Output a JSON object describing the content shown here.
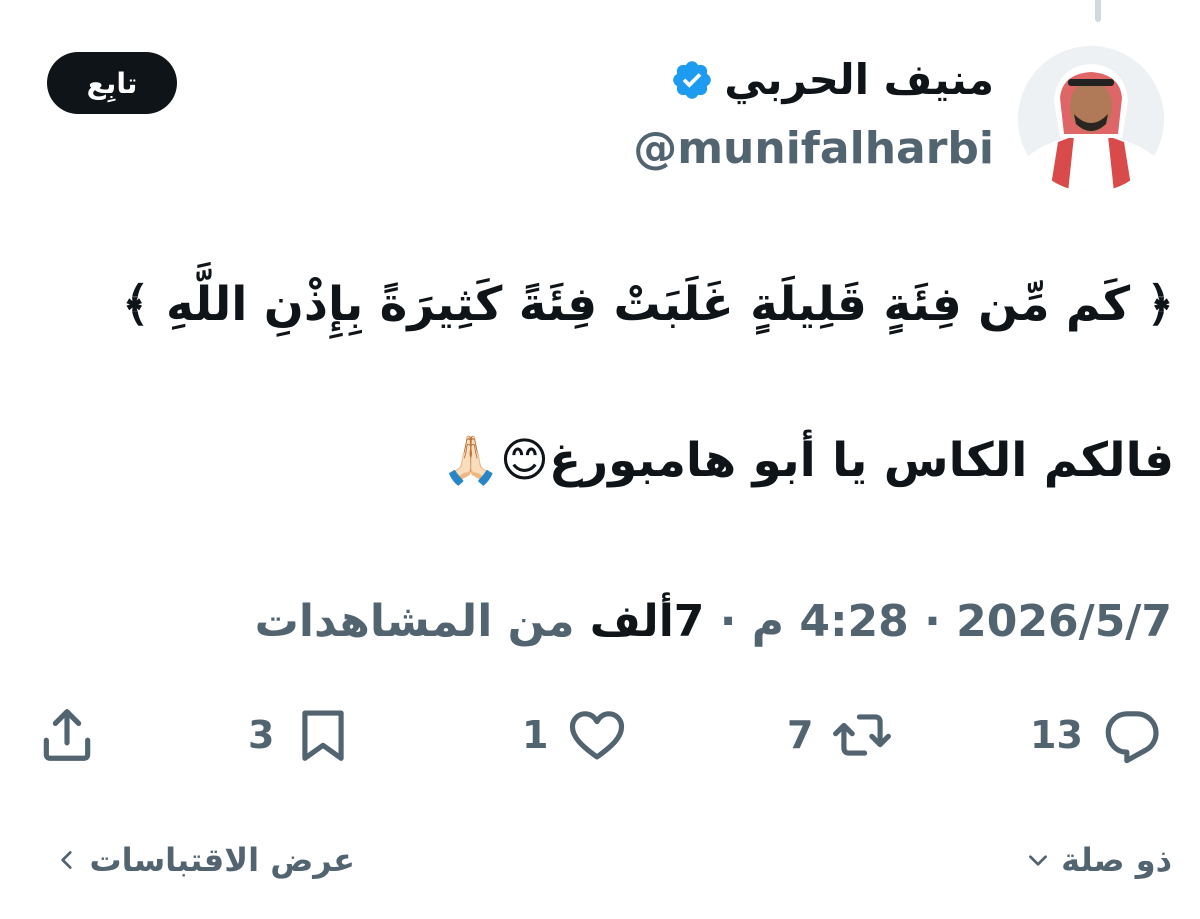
{
  "author": {
    "display_name": "منيف الحربي",
    "handle": "@munifalharbi",
    "verified": true
  },
  "follow_button": {
    "label": "تابِع"
  },
  "tweet": {
    "line1": "﴿ كَم مِّن فِئَةٍ قَلِيلَةٍ غَلَبَتْ فِئَةً كَثِيرَةً بِإِذْنِ اللَّهِ ﴾",
    "line2": "فالكم الكاس يا أبو هامبورغ😊🙏🏻"
  },
  "meta": {
    "date": "2026/5/7",
    "separator": " · ",
    "time": "4:28 م",
    "views_count": "7ألف",
    "views_label": " من المشاهدات"
  },
  "actions": {
    "replies": "13",
    "reposts": "7",
    "likes": "1",
    "bookmarks": "3"
  },
  "footer": {
    "relevance": "ذو صلة",
    "quotes": "عرض الاقتباسات"
  },
  "icons": {
    "verified": "verified-badge-icon",
    "reply": "reply-icon",
    "repost": "repost-icon",
    "like": "heart-icon",
    "bookmark": "bookmark-icon",
    "share": "share-icon",
    "chevron_down": "chevron-down-icon",
    "chevron_left": "chevron-left-icon"
  },
  "colors": {
    "text": "#0f1419",
    "secondary": "#536471",
    "verified": "#1d9bf0",
    "button_bg": "#0f1419"
  }
}
